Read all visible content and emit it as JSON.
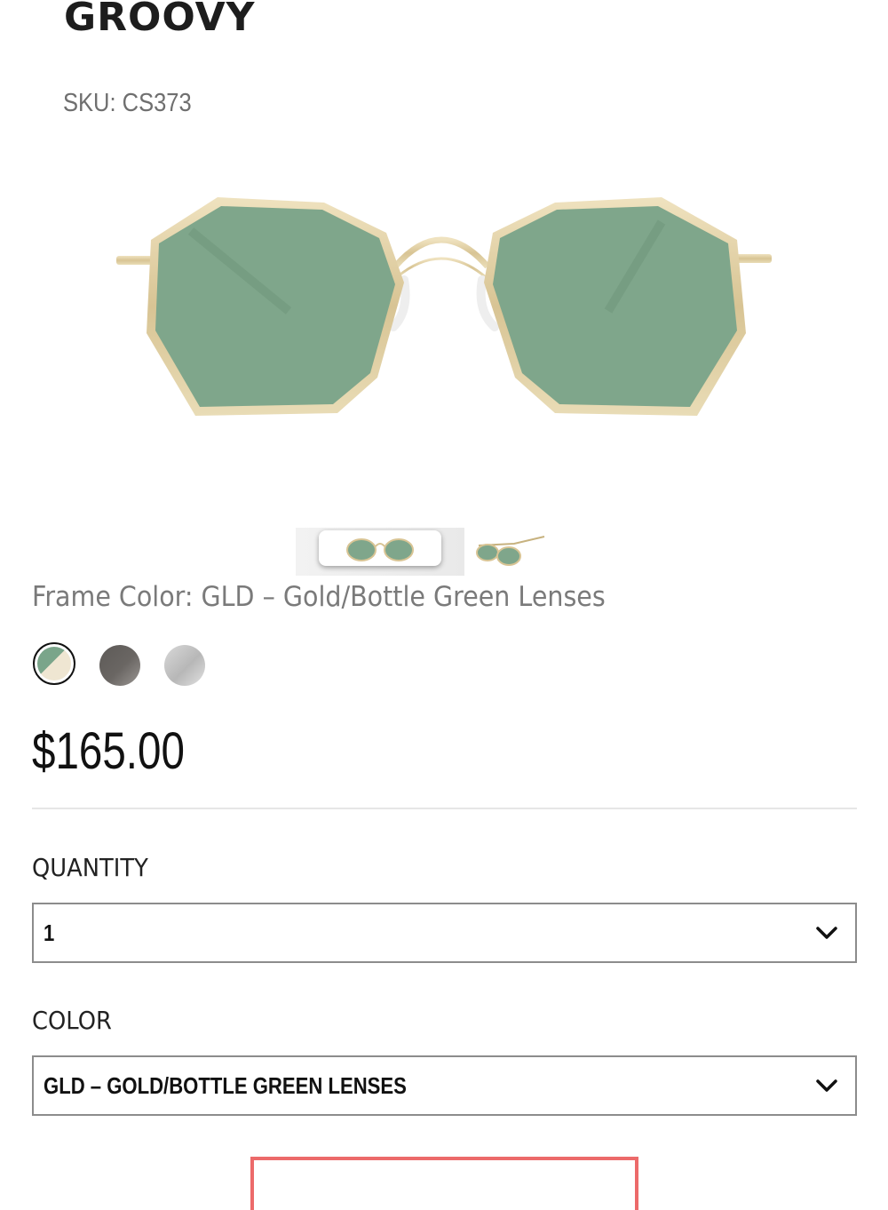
{
  "product": {
    "title": "GROOVY",
    "sku": "SKU: CS373",
    "frame_color_text": "Frame Color: GLD – Gold/Bottle Green Lenses",
    "price": "$165.00"
  },
  "gallery": {
    "main_image": "sunglasses-front-image",
    "thumbnails": [
      "thumbnail-front",
      "thumbnail-side"
    ],
    "selected_thumbnail": 0
  },
  "swatches": [
    {
      "name": "gold-bottle-green",
      "selected": true
    },
    {
      "name": "dark-grey",
      "selected": false
    },
    {
      "name": "silver",
      "selected": false
    }
  ],
  "quantity": {
    "label": "QUANTITY",
    "value": "1"
  },
  "color": {
    "label": "COLOR",
    "value": "GLD – GOLD/BOTTLE GREEN LENSES"
  },
  "colors": {
    "lens": "#7fa68b",
    "frame": "#d9c79b",
    "cta_border": "#ec6a6a",
    "divider": "#e6e6e6"
  },
  "icons": {
    "select_chevron": "chevron-down-icon"
  }
}
